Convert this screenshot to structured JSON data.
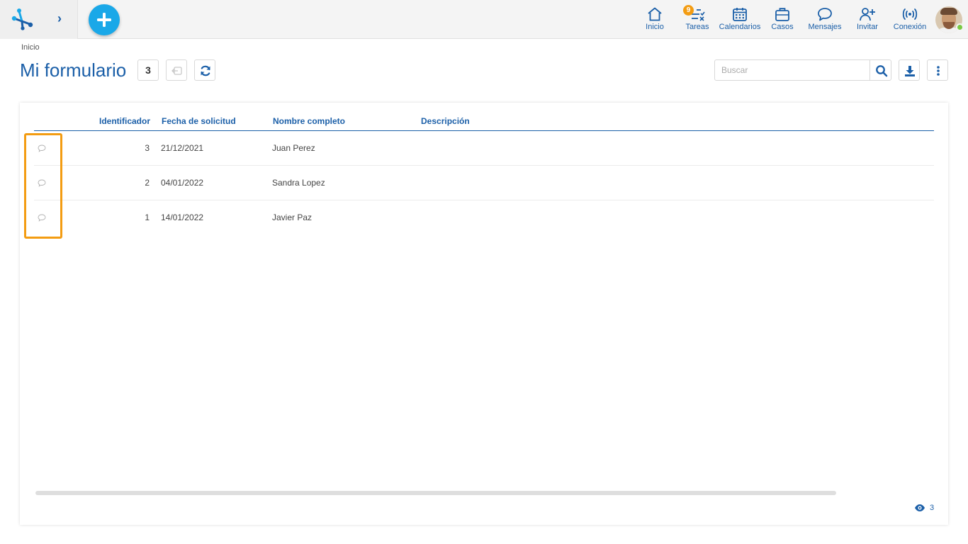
{
  "topbar": {
    "expand_label": "›",
    "nav": [
      {
        "id": "inicio",
        "label": "Inicio",
        "icon": "home-icon"
      },
      {
        "id": "tareas",
        "label": "Tareas",
        "icon": "tasks-icon",
        "badge": "9"
      },
      {
        "id": "calendarios",
        "label": "Calendarios",
        "icon": "calendar-icon"
      },
      {
        "id": "casos",
        "label": "Casos",
        "icon": "briefcase-icon"
      },
      {
        "id": "mensajes",
        "label": "Mensajes",
        "icon": "message-icon"
      },
      {
        "id": "invitar",
        "label": "Invitar",
        "icon": "invite-user-icon"
      },
      {
        "id": "conexion",
        "label": "Conexión",
        "icon": "connection-icon"
      }
    ],
    "avatar": "user-avatar",
    "status": "online",
    "accent": "#1b5fa8",
    "badge_color": "#f39c12",
    "fab_color": "#1aa8e8"
  },
  "breadcrumb": "Inicio",
  "page": {
    "title": "Mi formulario",
    "count": "3"
  },
  "search": {
    "placeholder": "Buscar",
    "value": ""
  },
  "table": {
    "columns": [
      "Identificador",
      "Fecha de solicitud",
      "Nombre completo",
      "Descripción"
    ],
    "rows": [
      {
        "id": "3",
        "fecha": "21/12/2021",
        "nombre": "Juan Perez",
        "descripcion": ""
      },
      {
        "id": "2",
        "fecha": "04/01/2022",
        "nombre": "Sandra Lopez",
        "descripcion": ""
      },
      {
        "id": "1",
        "fecha": "14/01/2022",
        "nombre": "Javier Paz",
        "descripcion": ""
      }
    ]
  },
  "footer": {
    "views": "3"
  },
  "highlight_color": "#f39c12"
}
